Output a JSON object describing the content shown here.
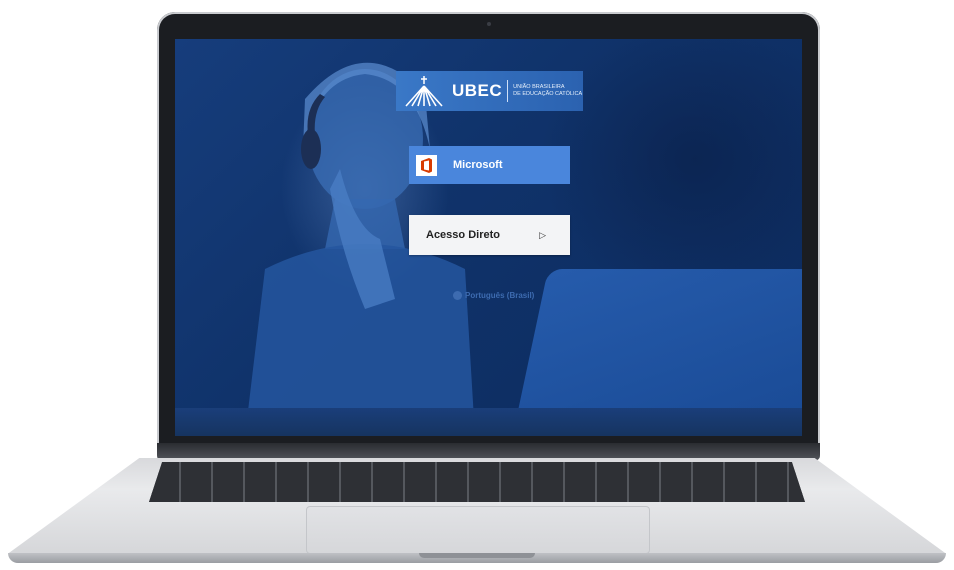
{
  "logo": {
    "name": "UBEC",
    "subtitle_line1": "UNIÃO BRASILEIRA",
    "subtitle_line2": "DE EDUCAÇÃO CATÓLICA"
  },
  "login": {
    "microsoft_label": "Microsoft",
    "direct_label": "Acesso Direto",
    "language": "Português (Brasil)"
  },
  "icons": {
    "office": "office-icon",
    "arrow": "play-arrow-icon",
    "globe": "globe-icon"
  },
  "colors": {
    "screen_bg": "#10336b",
    "microsoft_button": "#4a86dc",
    "direct_button": "#f3f4f6",
    "office_red": "#d83b01"
  }
}
